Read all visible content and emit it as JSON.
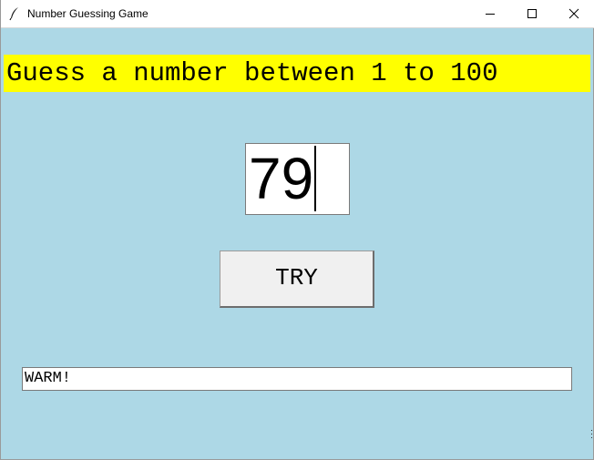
{
  "window": {
    "title": "Number Guessing Game",
    "background": "#add8e6",
    "icons": {
      "app": "feather-icon",
      "minimize": "minimize-icon",
      "maximize": "maximize-icon",
      "close": "close-icon"
    }
  },
  "game": {
    "heading": "Guess a number between 1 to 100",
    "heading_background": "#ffff00",
    "guess_value": "79",
    "try_label": "TRY",
    "result_text": "WARM!"
  }
}
